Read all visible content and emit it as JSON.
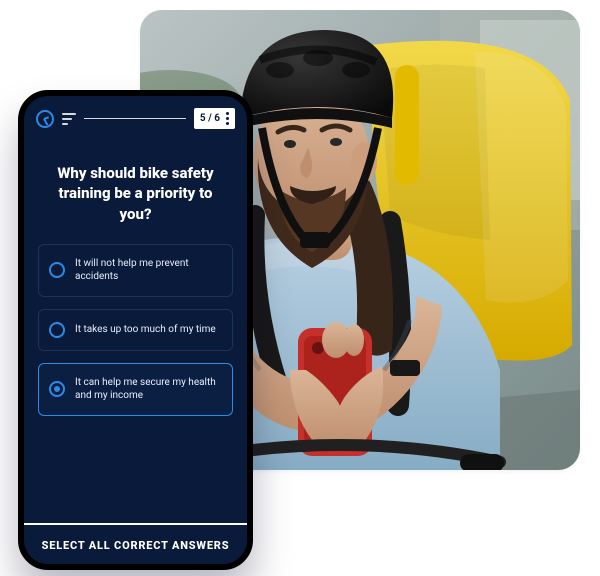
{
  "photo": {
    "alt": "Bearded delivery cyclist wearing a black helmet and light blue t-shirt, looking at a red smartphone, with a yellow insulated delivery backpack behind him."
  },
  "quiz": {
    "counter": "5 / 6",
    "question": "Why should bike safety training be a priority to you?",
    "options": [
      {
        "label": "It will not help me prevent accidents",
        "selected": false
      },
      {
        "label": "It takes up too much of my time",
        "selected": false
      },
      {
        "label": "It can help me secure my health and my income",
        "selected": true
      }
    ],
    "instruction": "SELECT ALL CORRECT ANSWERS"
  }
}
